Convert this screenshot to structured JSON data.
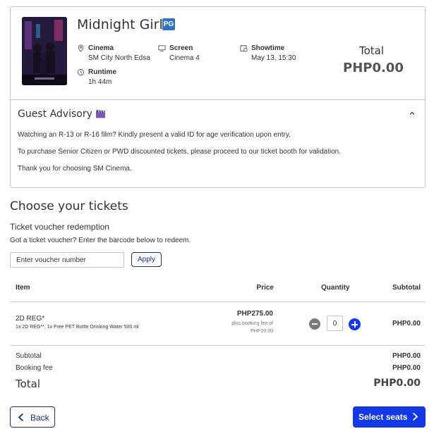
{
  "movie": {
    "title": "Midnight Girls",
    "rating": "PG",
    "cinema_label": "Cinema",
    "cinema_value": "SM City North Edsa",
    "screen_label": "Screen",
    "screen_value": "Cinema 4",
    "showtime_label": "Showtime",
    "showtime_value": "May 13, 15:30",
    "runtime_label": "Runtime",
    "runtime_value": "1h 44m",
    "total_label": "Total",
    "total_value": "PHP0.00"
  },
  "advisory": {
    "title": "Guest Advisory",
    "lines": [
      "Watching an R-13 or R-16 film? Kindly present a valid ID for age verification upon entry.",
      "To purchase Senior Citizen or PWD discounted tickets, please proceed to our ticket booth for validation.",
      "Thank you for choosing SM Cinema."
    ]
  },
  "tickets": {
    "heading": "Choose your tickets",
    "voucher_title": "Ticket voucher redemption",
    "voucher_desc": "Got a ticket voucher? Enter the barcode below to redeem.",
    "voucher_placeholder": "Enter voucher number",
    "apply_label": "Apply",
    "columns": [
      "Item",
      "Price",
      "Quantity",
      "Subtotal"
    ],
    "row": {
      "name": "2D REG*",
      "desc": "1x 2D REG**, 1x Free PET Bottle Drinking Water 500 ml",
      "price": "PHP275.00",
      "fee_note": "plus booking fee of PHP20.00",
      "quantity": "0",
      "subtotal": "PHP0.00"
    },
    "summary": {
      "subtotal_label": "Subtotal",
      "subtotal_value": "PHP0.00",
      "booking_fee_label": "Booking fee",
      "booking_fee_value": "PHP0.00",
      "total_label": "Total",
      "total_value": "PHP0.00"
    }
  },
  "actions": {
    "back_label": "Back",
    "next_label": "Select seats"
  },
  "colors": {
    "primary": "#1338e8",
    "navy": "#1a2f7a",
    "pg_badge": "#2f72c4"
  }
}
